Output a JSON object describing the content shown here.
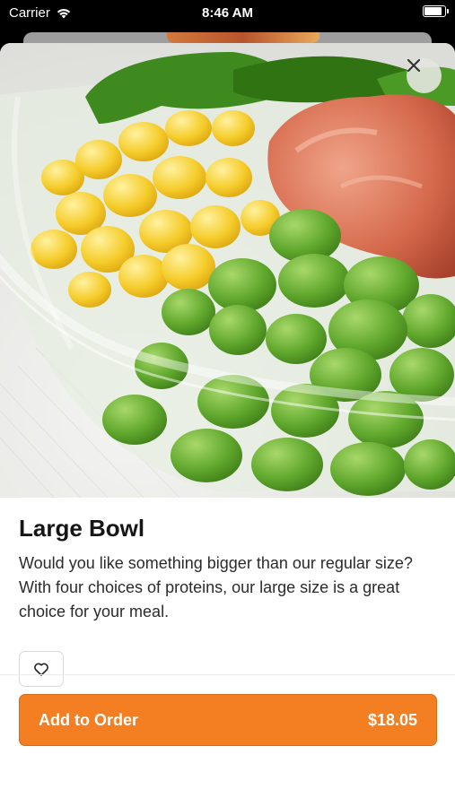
{
  "status_bar": {
    "carrier": "Carrier",
    "time": "8:46 AM"
  },
  "hero": {
    "image_description_icon": "salad-bowl-photo",
    "close_icon": "close-icon"
  },
  "item": {
    "title": "Large Bowl",
    "description": "Would you like something bigger than our regular size? With four choices of proteins, our large size is a great choice for your meal."
  },
  "favorite": {
    "icon": "heart-icon"
  },
  "order_button": {
    "label": "Add to Order",
    "price": "$18.05"
  },
  "colors": {
    "accent": "#f47f22",
    "text_primary": "#161616"
  }
}
